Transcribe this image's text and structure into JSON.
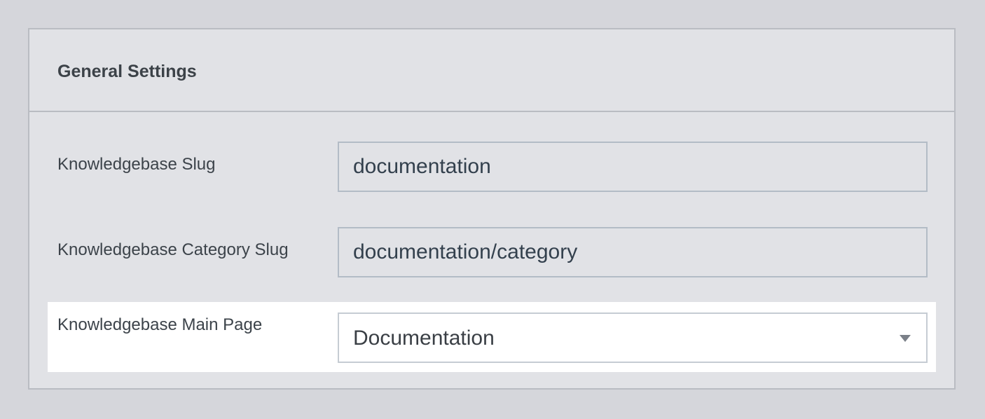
{
  "panel": {
    "title": "General Settings"
  },
  "fields": {
    "kb_slug": {
      "label": "Knowledgebase Slug",
      "value": "documentation"
    },
    "kb_category_slug": {
      "label": "Knowledgebase Category Slug",
      "value": "documentation/category"
    },
    "kb_main_page": {
      "label": "Knowledgebase Main Page",
      "selected": "Documentation"
    }
  },
  "colors": {
    "page_background": "#d5d6db",
    "panel_background": "#e1e2e6",
    "panel_border": "#b9bcc2",
    "highlight_background": "#ffffff"
  }
}
